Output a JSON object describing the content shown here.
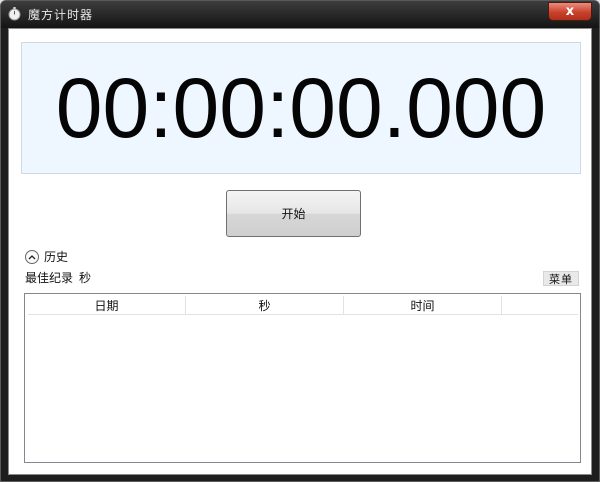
{
  "window": {
    "title": "魔方计时器",
    "close_glyph": "x"
  },
  "timer": {
    "display": "00:00:00.000"
  },
  "controls": {
    "start_label": "开始"
  },
  "history": {
    "toggle_label": "历史",
    "best_label": "最佳纪录",
    "best_unit": "秒",
    "menu_label": "菜单"
  },
  "table": {
    "columns": [
      "日期",
      "秒",
      "时间",
      ""
    ],
    "rows": []
  },
  "colors": {
    "display_bg": "#eef6ff",
    "close_red": "#c9412b",
    "titlebar": "#141414"
  }
}
